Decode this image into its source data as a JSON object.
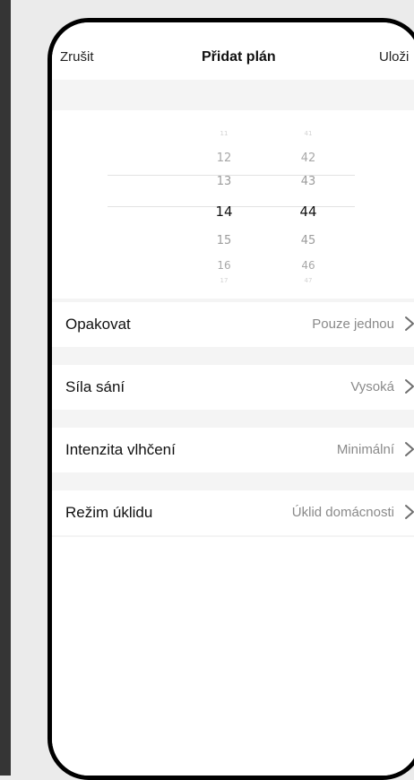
{
  "nav": {
    "cancel_label": "Zrušit",
    "title": "Přidat plán",
    "save_label": "Uloži"
  },
  "picker": {
    "hours": [
      "11",
      "12",
      "13",
      "14",
      "15",
      "16",
      "17"
    ],
    "minutes": [
      "41",
      "42",
      "43",
      "44",
      "45",
      "46",
      "47"
    ],
    "selected_hour": "14",
    "selected_minute": "44"
  },
  "settings": [
    {
      "label": "Opakovat",
      "value": "Pouze jednou"
    },
    {
      "label": "Síla sání",
      "value": "Vysoká"
    },
    {
      "label": "Intenzita vlhčení",
      "value": "Minimální"
    },
    {
      "label": "Režim úklidu",
      "value": "Úklid domácnosti"
    }
  ],
  "colors": {
    "background": "#ebebeb",
    "section_gap": "#f4f4f4",
    "value_text": "#8a8a8a",
    "selected_text": "#111111"
  },
  "icons": {
    "row_chevron": "chevron-right-icon"
  }
}
